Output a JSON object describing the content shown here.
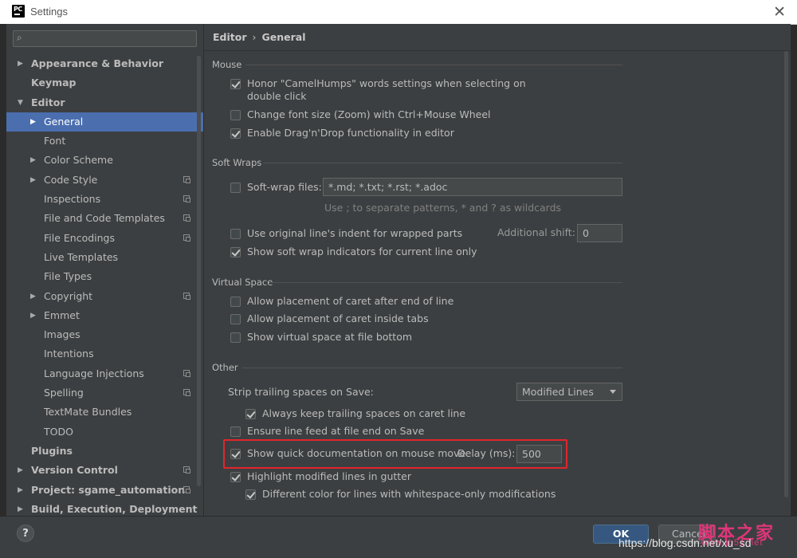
{
  "window": {
    "title": "Settings",
    "app_logo_text": "PC",
    "close_glyph": "✕"
  },
  "search": {
    "placeholder": "",
    "icon": "search-icon"
  },
  "sidebar": {
    "items": [
      {
        "label": "Appearance & Behavior",
        "level": 0,
        "bold": true,
        "arrow": "▶",
        "selected": false,
        "proj": false
      },
      {
        "label": "Keymap",
        "level": 0,
        "bold": true,
        "arrow": "",
        "selected": false,
        "proj": false
      },
      {
        "label": "Editor",
        "level": 0,
        "bold": true,
        "arrow": "▼",
        "selected": false,
        "proj": false
      },
      {
        "label": "General",
        "level": 1,
        "bold": false,
        "arrow": "▶",
        "selected": true,
        "proj": false
      },
      {
        "label": "Font",
        "level": 1,
        "bold": false,
        "arrow": "",
        "selected": false,
        "proj": false
      },
      {
        "label": "Color Scheme",
        "level": 1,
        "bold": false,
        "arrow": "▶",
        "selected": false,
        "proj": false
      },
      {
        "label": "Code Style",
        "level": 1,
        "bold": false,
        "arrow": "▶",
        "selected": false,
        "proj": true
      },
      {
        "label": "Inspections",
        "level": 1,
        "bold": false,
        "arrow": "",
        "selected": false,
        "proj": true
      },
      {
        "label": "File and Code Templates",
        "level": 1,
        "bold": false,
        "arrow": "",
        "selected": false,
        "proj": true
      },
      {
        "label": "File Encodings",
        "level": 1,
        "bold": false,
        "arrow": "",
        "selected": false,
        "proj": true
      },
      {
        "label": "Live Templates",
        "level": 1,
        "bold": false,
        "arrow": "",
        "selected": false,
        "proj": false
      },
      {
        "label": "File Types",
        "level": 1,
        "bold": false,
        "arrow": "",
        "selected": false,
        "proj": false
      },
      {
        "label": "Copyright",
        "level": 1,
        "bold": false,
        "arrow": "▶",
        "selected": false,
        "proj": true
      },
      {
        "label": "Emmet",
        "level": 1,
        "bold": false,
        "arrow": "▶",
        "selected": false,
        "proj": false
      },
      {
        "label": "Images",
        "level": 1,
        "bold": false,
        "arrow": "",
        "selected": false,
        "proj": false
      },
      {
        "label": "Intentions",
        "level": 1,
        "bold": false,
        "arrow": "",
        "selected": false,
        "proj": false
      },
      {
        "label": "Language Injections",
        "level": 1,
        "bold": false,
        "arrow": "",
        "selected": false,
        "proj": true
      },
      {
        "label": "Spelling",
        "level": 1,
        "bold": false,
        "arrow": "",
        "selected": false,
        "proj": true
      },
      {
        "label": "TextMate Bundles",
        "level": 1,
        "bold": false,
        "arrow": "",
        "selected": false,
        "proj": false
      },
      {
        "label": "TODO",
        "level": 1,
        "bold": false,
        "arrow": "",
        "selected": false,
        "proj": false
      },
      {
        "label": "Plugins",
        "level": 0,
        "bold": true,
        "arrow": "",
        "selected": false,
        "proj": false
      },
      {
        "label": "Version Control",
        "level": 0,
        "bold": true,
        "arrow": "▶",
        "selected": false,
        "proj": true
      },
      {
        "label": "Project: sgame_automation",
        "level": 0,
        "bold": true,
        "arrow": "▶",
        "selected": false,
        "proj": true
      },
      {
        "label": "Build, Execution, Deployment",
        "level": 0,
        "bold": true,
        "arrow": "▶",
        "selected": false,
        "proj": false
      }
    ]
  },
  "breadcrumb": {
    "parent": "Editor",
    "separator": "›",
    "current": "General"
  },
  "mouse": {
    "title": "Mouse",
    "camelhumps_line1": "Honor \"CamelHumps\" words settings when selecting on",
    "camelhumps_line2": "double click",
    "zoom": "Change font size (Zoom) with Ctrl+Mouse Wheel",
    "dragdrop": "Enable Drag'n'Drop functionality in editor"
  },
  "soft_wraps": {
    "title": "Soft Wraps",
    "softwrap_files": "Soft-wrap files:",
    "patterns_value": "*.md; *.txt; *.rst; *.adoc",
    "patterns_hint": "Use ; to separate patterns, * and ? as wildcards",
    "original_indent": "Use original line's indent for wrapped parts",
    "additional_shift_label": "Additional shift:",
    "additional_shift_value": "0",
    "wrap_indicators": "Show soft wrap indicators for current line only"
  },
  "virtual_space": {
    "title": "Virtual Space",
    "caret_after_end": "Allow placement of caret after end of line",
    "caret_inside_tabs": "Allow placement of caret inside tabs",
    "virtual_space_bottom": "Show virtual space at file bottom"
  },
  "other": {
    "title": "Other",
    "strip_label": "Strip trailing spaces on Save:",
    "strip_value": "Modified Lines",
    "keep_trailing": "Always keep trailing spaces on caret line",
    "ensure_linefeed": "Ensure line feed at file end on Save",
    "quick_doc": "Show quick documentation on mouse move",
    "delay_label": "Delay (ms):",
    "delay_value": "500",
    "highlight_modified": "Highlight modified lines in gutter",
    "whitespace_modifications": "Different color for lines with whitespace-only modifications"
  },
  "buttons": {
    "help": "?",
    "ok": "OK",
    "cancel": "Cancel"
  },
  "watermark": {
    "url": "https://blog.csdn.net/xu_sd",
    "brand": "脚本之家",
    "site": "www.jb51.net"
  },
  "colors": {
    "selection": "#4b6eaf",
    "highlight_box": "#e2252b",
    "ok_button": "#365880"
  }
}
